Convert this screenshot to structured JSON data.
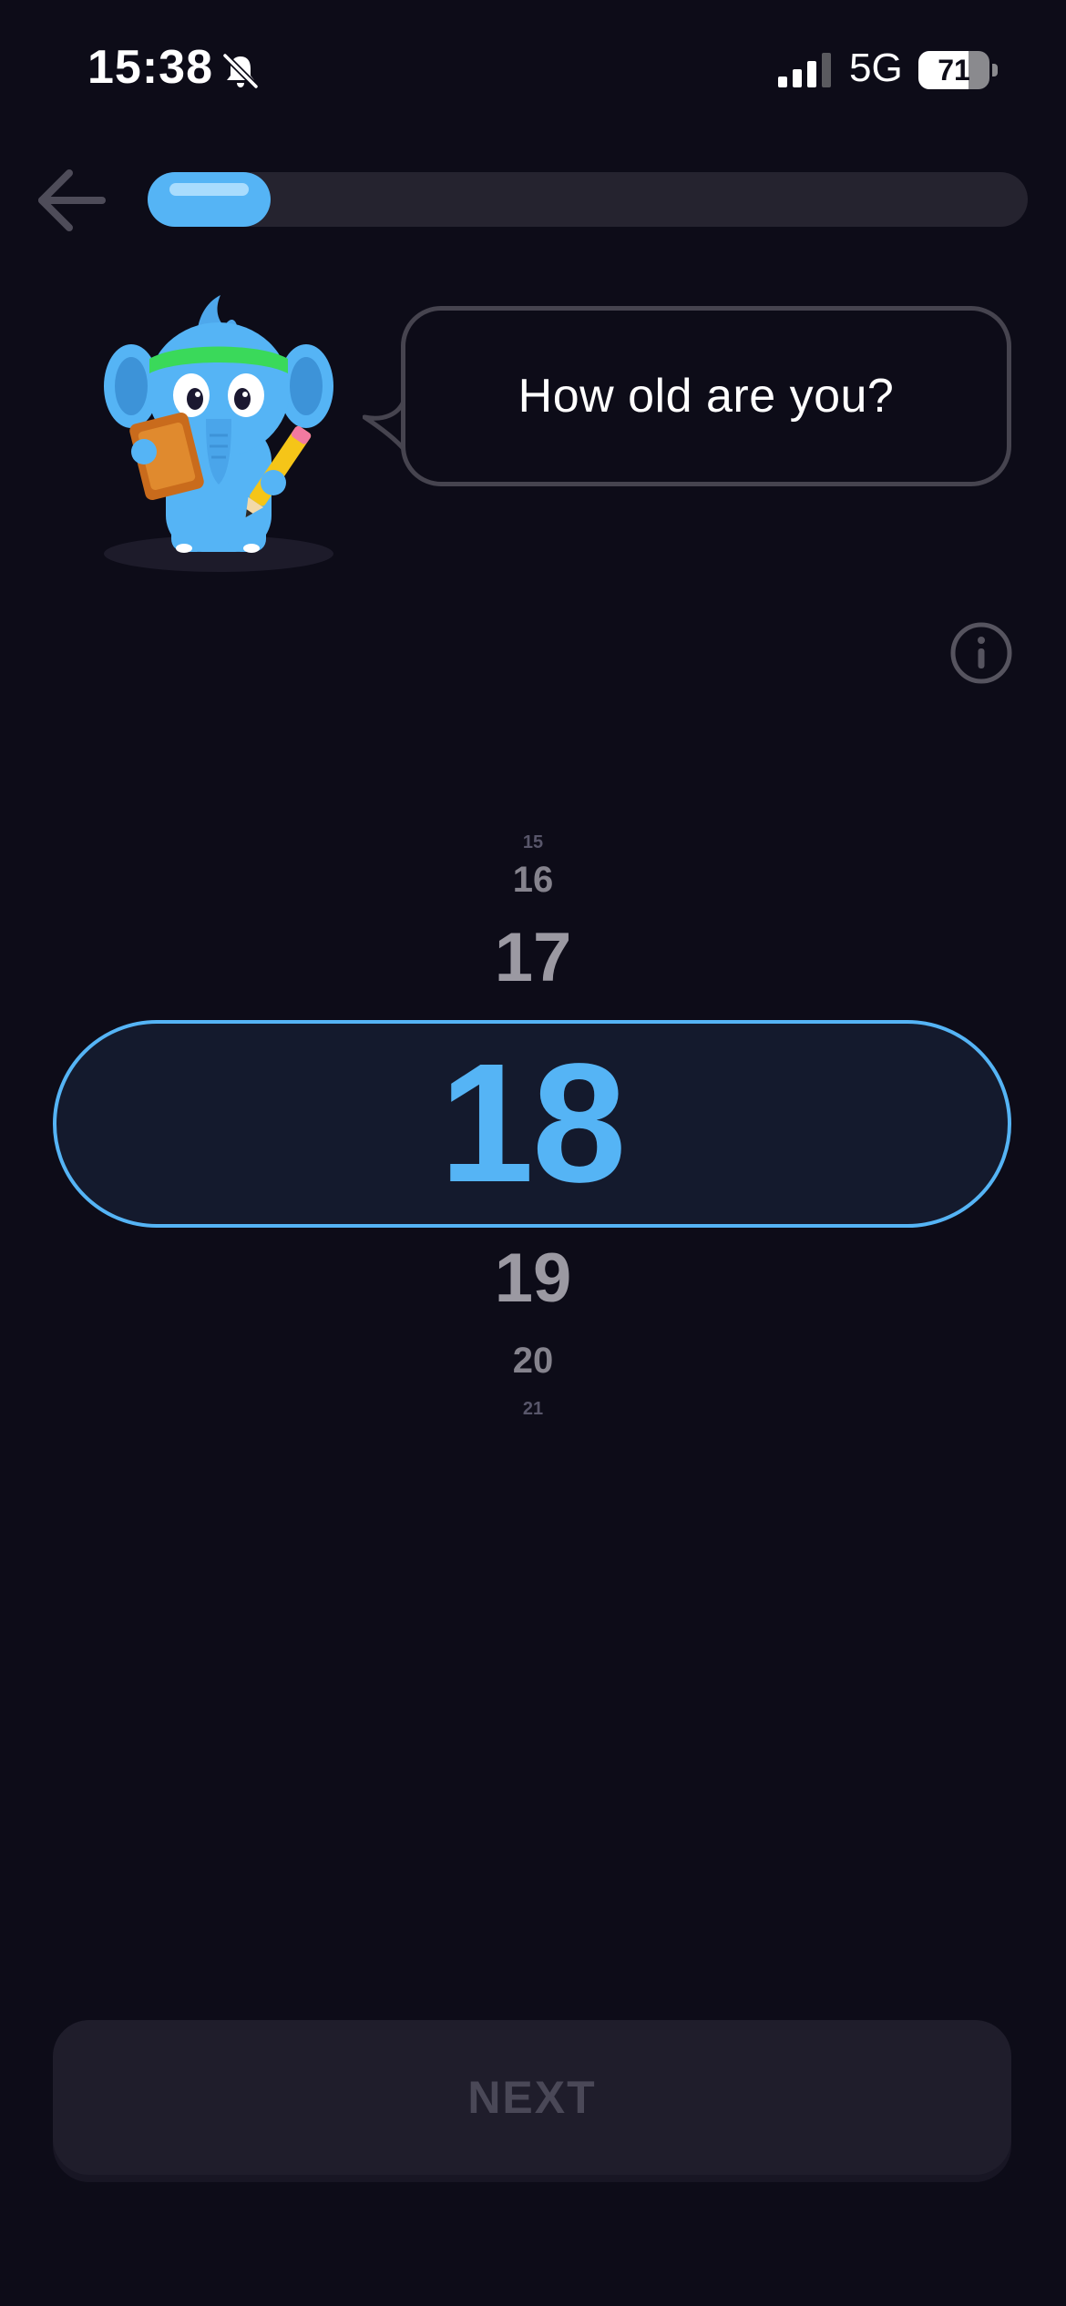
{
  "status_bar": {
    "time": "15:38",
    "silent_icon": "bell-slash-icon",
    "signal_icon": "cellular-signal-icon",
    "signal_bars_active": 3,
    "signal_bars_total": 4,
    "network": "5G",
    "battery_level": "71",
    "battery_fraction": 0.71
  },
  "header": {
    "back_icon": "arrow-left-icon",
    "progress_fraction": 0.14
  },
  "mascot": {
    "icon": "elephant-mascot-with-notepad-icon"
  },
  "prompt": {
    "question": "How old are you?"
  },
  "info": {
    "icon": "info-circle-icon"
  },
  "age_picker": {
    "above": [
      "15",
      "16",
      "17"
    ],
    "selected": "18",
    "below": [
      "19",
      "20",
      "21"
    ]
  },
  "footer": {
    "next_label": "NEXT"
  },
  "colors": {
    "background": "#0d0c18",
    "accent": "#55b4f5",
    "progress_track": "#25232f",
    "disabled_button": "#1f1d2b",
    "disabled_text": "#4a4857"
  }
}
